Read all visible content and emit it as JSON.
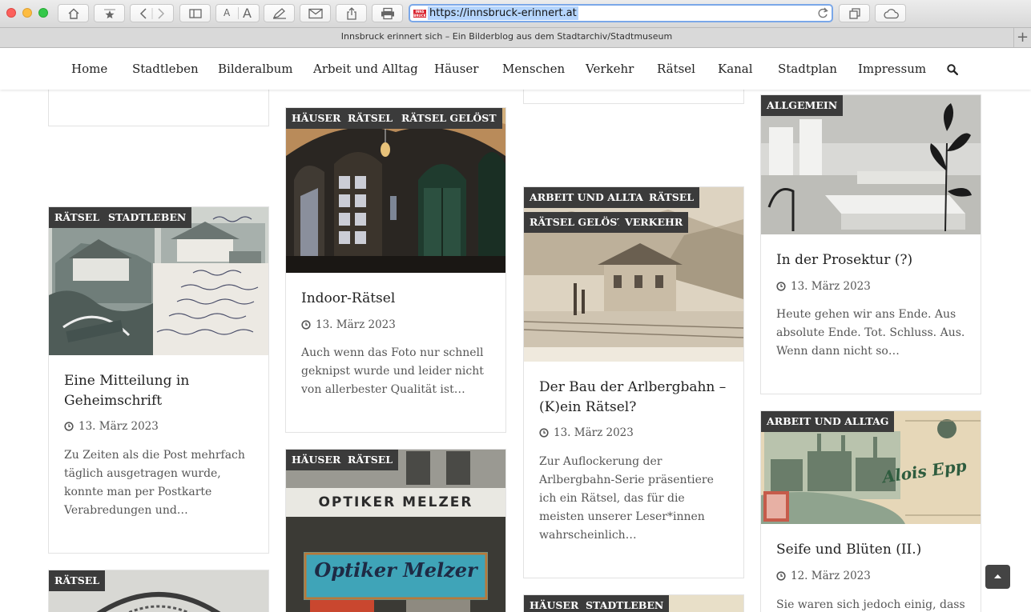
{
  "browser": {
    "url": "https://innsbruck-erinnert.at",
    "tab_title": "Innsbruck erinnert sich – Ein Bilderblog aus dem Stadtarchiv/Stadtmuseum",
    "font_small": "A",
    "font_large": "A",
    "new_tab": "+"
  },
  "nav": {
    "items": [
      "Home",
      "Stadtleben",
      "Bilderalbum",
      "Arbeit und Alltag",
      "Häuser",
      "Menschen",
      "Verkehr",
      "Rätsel",
      "Kanal",
      "Stadtplan",
      "Impressum"
    ]
  },
  "cards": {
    "geheimschrift": {
      "tags": [
        "RÄTSEL",
        "STADTLEBEN"
      ],
      "title": "Eine Mitteilung in Geheimschrift",
      "date": "13. März 2023",
      "excerpt": "Zu Zeiten als die Post mehrfach täglich ausgetragen wurde, konnte man per Postkarte Verabredungen und…"
    },
    "indoor": {
      "tags": [
        "HÄUSER",
        "RÄTSEL",
        "RÄTSEL GELÖST"
      ],
      "title": "Indoor-Rätsel",
      "date": "13. März 2023",
      "excerpt": "Auch wenn das Foto nur schnell geknipst wurde und leider nicht von allerbester Qualität ist…"
    },
    "optiker": {
      "tags": [
        "HÄUSER",
        "RÄTSEL"
      ],
      "sign_top": "OPTIKER MELZER",
      "sign_script": "Optiker Melzer"
    },
    "arlberg": {
      "tags": [
        "ARBEIT UND ALLTAG",
        "RÄTSEL",
        "RÄTSEL GELÖST",
        "VERKEHR"
      ],
      "title": "Der Bau der Arlbergbahn – (K)ein Rätsel?",
      "date": "13. März 2023",
      "excerpt": "Zur Auflockerung der Arlbergbahn-Serie präsentiere ich ein Rätsel, das für die meisten unserer Leser*innen wahrscheinlich…"
    },
    "prosektur": {
      "tags": [
        "ALLGEMEIN"
      ],
      "title": "In der Prosektur (?)",
      "date": "13. März 2023",
      "excerpt": "Heute gehen wir ans Ende. Aus absolute Ende. Tot. Schluss. Aus. Wenn dann nicht so…"
    },
    "seife": {
      "tags": [
        "ARBEIT UND ALLTAG"
      ],
      "title": "Seife und Blüten (II.)",
      "date": "12. März 2023",
      "excerpt": "Sie waren sich jedoch einig, dass"
    },
    "raetsel_bottom": {
      "tags": [
        "RÄTSEL"
      ]
    },
    "haeuser_bottom": {
      "tags": [
        "HÄUSER",
        "STADTLEBEN"
      ]
    }
  },
  "colors": {
    "tag_bg": "#3b3b3b",
    "accent_url_border": "#7aa7e8"
  }
}
